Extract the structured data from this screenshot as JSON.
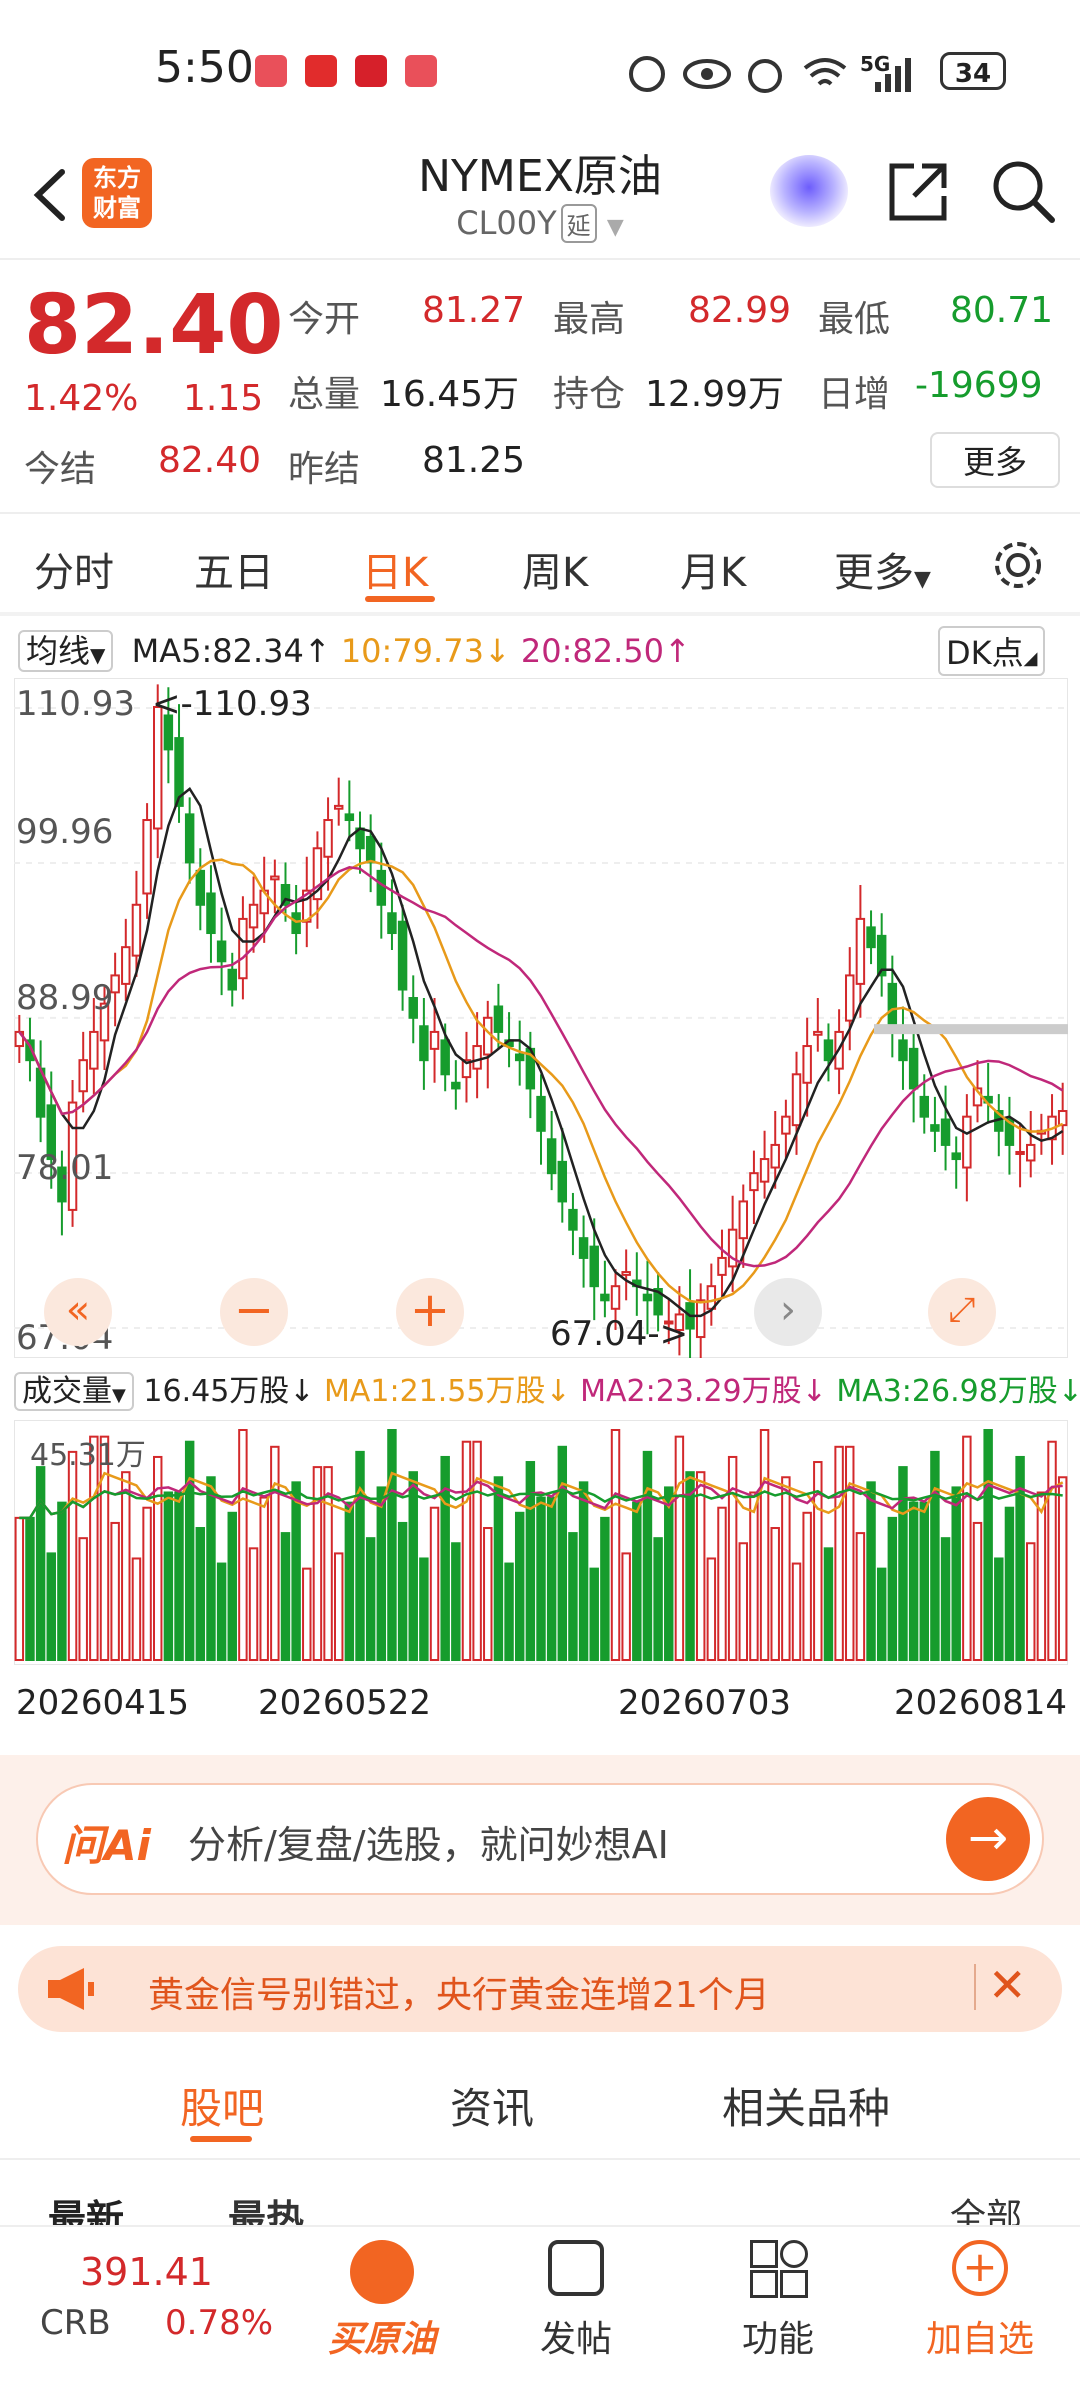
{
  "status": {
    "time": "5:50",
    "battery": "34",
    "network": "5G"
  },
  "header": {
    "title": "NYMEX原油",
    "code": "CL00Y",
    "tag": "延",
    "logo_line1": "东方",
    "logo_line2": "财富"
  },
  "quote": {
    "price": "82.40",
    "pct": "1.42%",
    "change": "1.15",
    "open_label": "今开",
    "open": "81.27",
    "high_label": "最高",
    "high": "82.99",
    "low_label": "最低",
    "low": "80.71",
    "volume_label": "总量",
    "volume": "16.45万",
    "position_label": "持仓",
    "position": "12.99万",
    "daily_label": "日增",
    "daily": "-19699",
    "settle_label": "今结",
    "settle": "82.40",
    "prev_label": "昨结",
    "prev": "81.25",
    "more": "更多"
  },
  "period_tabs": [
    "分时",
    "五日",
    "日K",
    "周K",
    "月K",
    "更多"
  ],
  "ma_legend": {
    "selector": "均线",
    "ma5": "MA5:82.34↑",
    "ma10": "10:79.73↓",
    "ma20": "20:82.50↑",
    "dk": "DK点"
  },
  "price_axis": [
    "110.93",
    "99.96",
    "88.99",
    "78.01",
    "67.04"
  ],
  "markers": {
    "high": "<-110.93",
    "low": "67.04->"
  },
  "volume_legend": {
    "selector": "成交量",
    "vol": "16.45万股↓",
    "ma1": "MA1:21.55万股↓",
    "ma2": "MA2:23.29万股↓",
    "ma3": "MA3:26.98万股↓",
    "max": "45.31万"
  },
  "dates": [
    "20260415",
    "20260522",
    "20260703",
    "20260814"
  ],
  "ai": {
    "brand": "问Ai",
    "placeholder": "分析/复盘/选股，就问妙想AI"
  },
  "notice": {
    "text": "黄金信号别错过，央行黄金连增21个月"
  },
  "bottom_tabs": [
    "股吧",
    "资讯",
    "相关品种"
  ],
  "sub_tabs": {
    "latest": "最新",
    "hot": "最热",
    "all": "全部"
  },
  "crb": {
    "value": "391.41",
    "label": "CRB",
    "pct": "0.78%"
  },
  "nav": {
    "buy": "买原油",
    "post": "发帖",
    "func": "功能",
    "add": "加自选"
  },
  "colors": {
    "up": "#d3292b",
    "down": "#169c2d",
    "accent": "#f26522",
    "ma5": "#222222",
    "ma10": "#e89a1a",
    "ma20": "#c0287a"
  },
  "chart_data": {
    "type": "candlestick",
    "y_range": [
      67.04,
      110.93
    ],
    "y_ticks": [
      110.93,
      99.96,
      88.99,
      78.01,
      67.04
    ],
    "closes": [
      88,
      86,
      82,
      79,
      76,
      83,
      86,
      88,
      90,
      92,
      94,
      97,
      103,
      111,
      108,
      104,
      100,
      97,
      95,
      93,
      91,
      96,
      97,
      98,
      99,
      97,
      95,
      98,
      101,
      103,
      104,
      103,
      101,
      100,
      97,
      95,
      91,
      89,
      86,
      88,
      85,
      84,
      86,
      87,
      89,
      88,
      87,
      86,
      84,
      81,
      78,
      76,
      74,
      72,
      70,
      69,
      70,
      71,
      70,
      69,
      68,
      67.5,
      68,
      67,
      69,
      70,
      72,
      74,
      76,
      78,
      79,
      80,
      82,
      85,
      87,
      88,
      86,
      88,
      92,
      96,
      94,
      92,
      88,
      86,
      84,
      82,
      81,
      80,
      79,
      82,
      84,
      83,
      81,
      80,
      79.5,
      80,
      81,
      82,
      82.4
    ],
    "volume_max": 45.31
  }
}
